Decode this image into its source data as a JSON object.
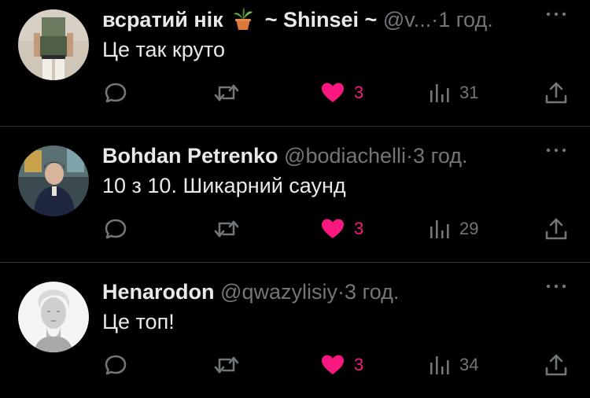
{
  "colors": {
    "background": "#000000",
    "text": "#e7e9ea",
    "muted": "#71767b",
    "like": "#f91880",
    "divider": "#2f3336"
  },
  "tweets": [
    {
      "name": "всратий нік",
      "name_emoji": "potted-plant-icon",
      "name_suffix": "~ Shinsei ~",
      "handle": "@v...",
      "dot": "·",
      "time": "1 год.",
      "text": "Це так круто",
      "likes": "3",
      "views": "31",
      "liked": true
    },
    {
      "name": "Bohdan Petrenko",
      "handle": "@bodiachelli",
      "dot": "·",
      "time": "3 год.",
      "text": "10 з 10. Шикарний саунд",
      "likes": "3",
      "views": "29",
      "liked": true
    },
    {
      "name": "Henarodon",
      "handle": "@qwazylisiy",
      "dot": "·",
      "time": "3 год.",
      "text": "Це топ!",
      "likes": "3",
      "views": "34",
      "liked": true
    }
  ]
}
